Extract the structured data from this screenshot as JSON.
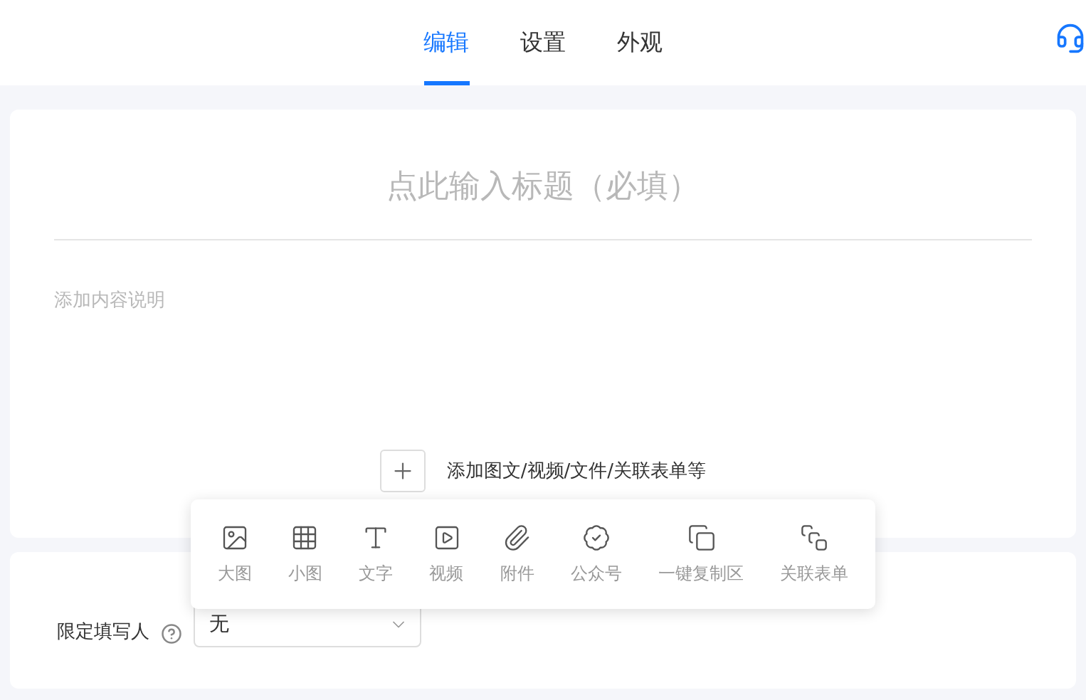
{
  "tabs": [
    {
      "label": "编辑",
      "selected": true
    },
    {
      "label": "设置",
      "selected": false
    },
    {
      "label": "外观",
      "selected": false
    }
  ],
  "form": {
    "title_placeholder": "点此输入标题（必填）",
    "description_placeholder": "添加内容说明",
    "add_label": "添加图文/视频/文件/关联表单等"
  },
  "insert_menu": [
    {
      "kind": "large-image",
      "label": "大图"
    },
    {
      "kind": "small-image",
      "label": "小图"
    },
    {
      "kind": "text",
      "label": "文字"
    },
    {
      "kind": "video",
      "label": "视频"
    },
    {
      "kind": "attachment",
      "label": "附件"
    },
    {
      "kind": "official-account",
      "label": "公众号"
    },
    {
      "kind": "copy-area",
      "label": "一键复制区"
    },
    {
      "kind": "linked-form",
      "label": "关联表单"
    }
  ],
  "settings": {
    "label": "限定填写人",
    "value": "无"
  }
}
